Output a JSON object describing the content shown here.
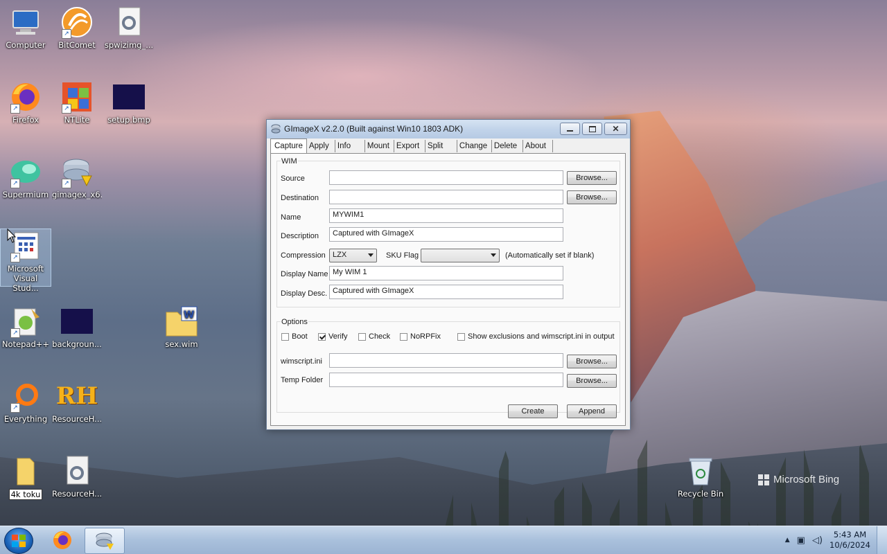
{
  "desktop": {
    "icons": [
      {
        "label": "Computer"
      },
      {
        "label": "BitComet"
      },
      {
        "label": "spwizimg_..."
      },
      {
        "label": "Firefox"
      },
      {
        "label": "NTLite"
      },
      {
        "label": "setup.bmp"
      },
      {
        "label": "Supermium"
      },
      {
        "label": "gimagex_x6..."
      },
      {
        "label": "Microsoft Visual Stud..."
      },
      {
        "label": "Notepad++"
      },
      {
        "label": "backgroun..."
      },
      {
        "label": "sex.wim"
      },
      {
        "label": "Everything"
      },
      {
        "label": "ResourceH..."
      },
      {
        "label": "4k toku"
      },
      {
        "label": "ResourceH..."
      },
      {
        "label": "Recycle Bin"
      }
    ],
    "watermark": "Microsoft Bing"
  },
  "window": {
    "title": "GImageX v2.2.0 (Built against Win10 1803 ADK)",
    "tabs": [
      {
        "label": "Capture"
      },
      {
        "label": "Apply"
      },
      {
        "label": "Info"
      },
      {
        "label": "Mount"
      },
      {
        "label": "Export"
      },
      {
        "label": "Split"
      },
      {
        "label": "Change"
      },
      {
        "label": "Delete"
      },
      {
        "label": "About"
      }
    ],
    "wim": {
      "group_label": "WIM",
      "source_label": "Source",
      "source_value": "",
      "destination_label": "Destination",
      "destination_value": "",
      "name_label": "Name",
      "name_value": "MYWIM1",
      "description_label": "Description",
      "description_value": "Captured with GImageX",
      "compression_label": "Compression",
      "compression_value": "LZX",
      "sku_label": "SKU Flag",
      "sku_value": "",
      "sku_hint": "(Automatically set if blank)",
      "display_name_label": "Display Name",
      "display_name_value": "My WIM 1",
      "display_desc_label": "Display Desc.",
      "display_desc_value": "Captured with GImageX",
      "browse_label": "Browse..."
    },
    "options": {
      "group_label": "Options",
      "boot": {
        "label": "Boot",
        "checked": false
      },
      "verify": {
        "label": "Verify",
        "checked": true
      },
      "check": {
        "label": "Check",
        "checked": false
      },
      "norpfix": {
        "label": "NoRPFix",
        "checked": false
      },
      "show_exclusions": {
        "label": "Show exclusions and wimscript.ini in output",
        "checked": false
      },
      "wimscript_label": "wimscript.ini",
      "wimscript_value": "",
      "temp_label": "Temp Folder",
      "temp_value": "",
      "browse_label": "Browse..."
    },
    "create_label": "Create",
    "append_label": "Append"
  },
  "taskbar": {
    "time": "5:43 AM",
    "date": "10/6/2024"
  },
  "colors": {
    "taskbar": "#a9c0dc",
    "window_bg": "#f0f0f0",
    "titlebar": "#c2d4ea"
  }
}
